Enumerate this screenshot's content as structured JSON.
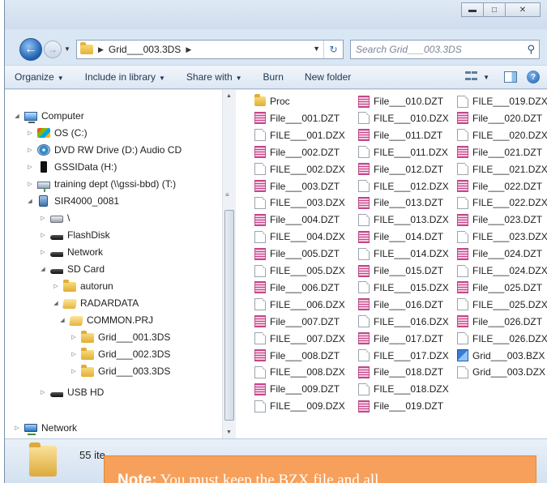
{
  "address": {
    "path": [
      "Grid___003.3DS"
    ],
    "search_placeholder": "Search Grid___003.3DS"
  },
  "toolbar": {
    "organize": "Organize",
    "include_in_library": "Include in library",
    "share_with": "Share with",
    "burn": "Burn",
    "new_folder": "New folder"
  },
  "nav": {
    "computer": "Computer",
    "os_c": "OS (C:)",
    "dvd": "DVD RW Drive (D:) Audio CD",
    "gssidata": "GSSIData (H:)",
    "training": "training dept (\\\\gssi-bbd) (T:)",
    "sir4000": "SIR4000_0081",
    "backslash": "\\",
    "flashdisk": "FlashDisk",
    "network_dev": "Network",
    "sdcard": "SD Card",
    "autorun": "autorun",
    "radardata": "RADARDATA",
    "commonprj": "COMMON.PRJ",
    "grid001": "Grid___001.3DS",
    "grid002": "Grid___002.3DS",
    "grid003": "Grid___003.3DS",
    "usbhd": "USB HD",
    "network": "Network"
  },
  "files": {
    "col1": [
      {
        "name": "Proc",
        "type": "folder"
      },
      {
        "name": "File___001.DZT",
        "type": "dzt"
      },
      {
        "name": "FILE___001.DZX",
        "type": "doc"
      },
      {
        "name": "File___002.DZT",
        "type": "dzt"
      },
      {
        "name": "FILE___002.DZX",
        "type": "doc"
      },
      {
        "name": "File___003.DZT",
        "type": "dzt"
      },
      {
        "name": "FILE___003.DZX",
        "type": "doc"
      },
      {
        "name": "File___004.DZT",
        "type": "dzt"
      },
      {
        "name": "FILE___004.DZX",
        "type": "doc"
      },
      {
        "name": "File___005.DZT",
        "type": "dzt"
      },
      {
        "name": "FILE___005.DZX",
        "type": "doc"
      },
      {
        "name": "File___006.DZT",
        "type": "dzt"
      },
      {
        "name": "FILE___006.DZX",
        "type": "doc"
      },
      {
        "name": "File___007.DZT",
        "type": "dzt"
      },
      {
        "name": "FILE___007.DZX",
        "type": "doc"
      },
      {
        "name": "File___008.DZT",
        "type": "dzt"
      },
      {
        "name": "FILE___008.DZX",
        "type": "doc"
      },
      {
        "name": "File___009.DZT",
        "type": "dzt"
      },
      {
        "name": "FILE___009.DZX",
        "type": "doc"
      }
    ],
    "col2": [
      {
        "name": "File___010.DZT",
        "type": "dzt"
      },
      {
        "name": "FILE___010.DZX",
        "type": "doc"
      },
      {
        "name": "File___011.DZT",
        "type": "dzt"
      },
      {
        "name": "FILE___011.DZX",
        "type": "doc"
      },
      {
        "name": "File___012.DZT",
        "type": "dzt"
      },
      {
        "name": "FILE___012.DZX",
        "type": "doc"
      },
      {
        "name": "File___013.DZT",
        "type": "dzt"
      },
      {
        "name": "FILE___013.DZX",
        "type": "doc"
      },
      {
        "name": "File___014.DZT",
        "type": "dzt"
      },
      {
        "name": "FILE___014.DZX",
        "type": "doc"
      },
      {
        "name": "File___015.DZT",
        "type": "dzt"
      },
      {
        "name": "FILE___015.DZX",
        "type": "doc"
      },
      {
        "name": "File___016.DZT",
        "type": "dzt"
      },
      {
        "name": "FILE___016.DZX",
        "type": "doc"
      },
      {
        "name": "File___017.DZT",
        "type": "dzt"
      },
      {
        "name": "FILE___017.DZX",
        "type": "doc"
      },
      {
        "name": "File___018.DZT",
        "type": "dzt"
      },
      {
        "name": "FILE___018.DZX",
        "type": "doc"
      },
      {
        "name": "File___019.DZT",
        "type": "dzt"
      }
    ],
    "col3": [
      {
        "name": "FILE___019.DZX",
        "type": "doc"
      },
      {
        "name": "File___020.DZT",
        "type": "dzt"
      },
      {
        "name": "FILE___020.DZX",
        "type": "doc"
      },
      {
        "name": "File___021.DZT",
        "type": "dzt"
      },
      {
        "name": "FILE___021.DZX",
        "type": "doc"
      },
      {
        "name": "File___022.DZT",
        "type": "dzt"
      },
      {
        "name": "FILE___022.DZX",
        "type": "doc"
      },
      {
        "name": "File___023.DZT",
        "type": "dzt"
      },
      {
        "name": "FILE___023.DZX",
        "type": "doc"
      },
      {
        "name": "File___024.DZT",
        "type": "dzt"
      },
      {
        "name": "FILE___024.DZX",
        "type": "doc"
      },
      {
        "name": "File___025.DZT",
        "type": "dzt"
      },
      {
        "name": "FILE___025.DZX",
        "type": "doc"
      },
      {
        "name": "File___026.DZT",
        "type": "dzt"
      },
      {
        "name": "FILE___026.DZX",
        "type": "doc"
      },
      {
        "name": "Grid___003.BZX",
        "type": "bzx"
      },
      {
        "name": "Grid___003.DZX",
        "type": "doc"
      }
    ]
  },
  "status": {
    "item_count": "55 ite"
  },
  "note": {
    "label": "Note:",
    "text": " You must keep the BZX file and all"
  },
  "colors": {
    "note_bg": "#f7a05b",
    "dzt_icon": "#c0307f",
    "toolbar_bg": "#dce7f3"
  }
}
